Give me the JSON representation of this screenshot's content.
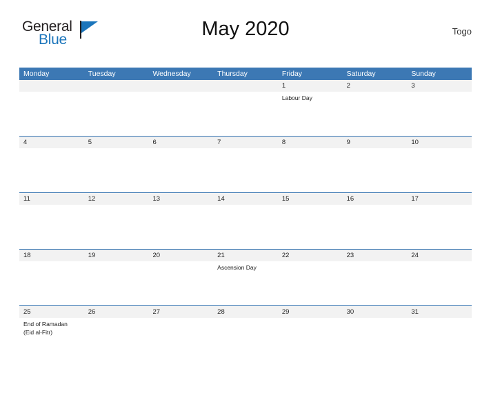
{
  "brand": {
    "name_part1": "General",
    "name_part2": "Blue",
    "flag_icon": "flag-icon"
  },
  "header": {
    "title": "May 2020",
    "country": "Togo"
  },
  "colors": {
    "header_blue": "#3c78b4",
    "row_rule_blue": "#2f6fae",
    "date_band_gray": "#f2f2f2",
    "brand_blue": "#1b75bb"
  },
  "calendar": {
    "weekdays": [
      "Monday",
      "Tuesday",
      "Wednesday",
      "Thursday",
      "Friday",
      "Saturday",
      "Sunday"
    ],
    "weeks": [
      {
        "days": [
          {
            "date": "",
            "events": []
          },
          {
            "date": "",
            "events": []
          },
          {
            "date": "",
            "events": []
          },
          {
            "date": "",
            "events": []
          },
          {
            "date": "1",
            "events": [
              "Labour Day"
            ]
          },
          {
            "date": "2",
            "events": []
          },
          {
            "date": "3",
            "events": []
          }
        ]
      },
      {
        "days": [
          {
            "date": "4",
            "events": []
          },
          {
            "date": "5",
            "events": []
          },
          {
            "date": "6",
            "events": []
          },
          {
            "date": "7",
            "events": []
          },
          {
            "date": "8",
            "events": []
          },
          {
            "date": "9",
            "events": []
          },
          {
            "date": "10",
            "events": []
          }
        ]
      },
      {
        "days": [
          {
            "date": "11",
            "events": []
          },
          {
            "date": "12",
            "events": []
          },
          {
            "date": "13",
            "events": []
          },
          {
            "date": "14",
            "events": []
          },
          {
            "date": "15",
            "events": []
          },
          {
            "date": "16",
            "events": []
          },
          {
            "date": "17",
            "events": []
          }
        ]
      },
      {
        "days": [
          {
            "date": "18",
            "events": []
          },
          {
            "date": "19",
            "events": []
          },
          {
            "date": "20",
            "events": []
          },
          {
            "date": "21",
            "events": [
              "Ascension Day"
            ]
          },
          {
            "date": "22",
            "events": []
          },
          {
            "date": "23",
            "events": []
          },
          {
            "date": "24",
            "events": []
          }
        ]
      },
      {
        "days": [
          {
            "date": "25",
            "events": [
              "End of Ramadan",
              "(Eid al-Fitr)"
            ]
          },
          {
            "date": "26",
            "events": []
          },
          {
            "date": "27",
            "events": []
          },
          {
            "date": "28",
            "events": []
          },
          {
            "date": "29",
            "events": []
          },
          {
            "date": "30",
            "events": []
          },
          {
            "date": "31",
            "events": []
          }
        ]
      }
    ]
  }
}
